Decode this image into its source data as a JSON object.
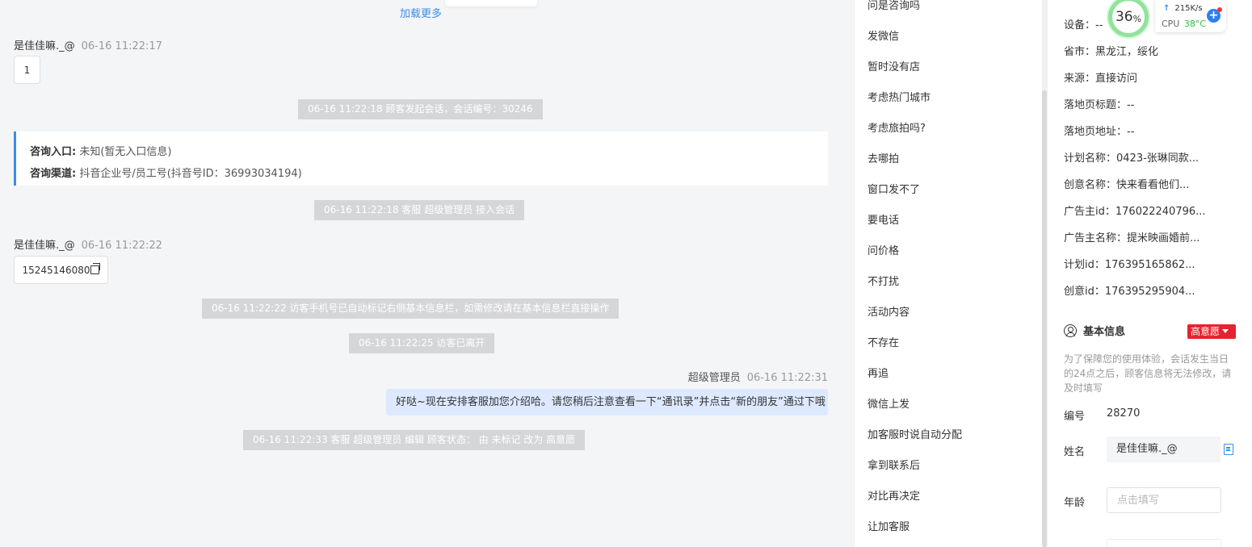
{
  "chat": {
    "load_more": "加载更多",
    "messages": [
      {
        "sender": "是佳佳嘛._@",
        "time": "06-16 11:22:17",
        "text": "1"
      },
      {
        "system": "06-16 11:22:18 顾客发起会话，会话编号：30246"
      },
      {
        "system": "06-16 11:22:18 客服 超级管理员 接入会话"
      },
      {
        "sender": "是佳佳嘛._@",
        "time": "06-16 11:22:22",
        "text": "15245146080"
      },
      {
        "system": "06-16 11:22:22 访客手机号已自动标记右侧基本信息栏，如需修改请在基本信息栏直接操作"
      },
      {
        "system": "06-16 11:22:25 访客已离开"
      },
      {
        "sender": "超级管理员",
        "time": "06-16 11:22:31",
        "text": "好哒~现在安排客服加您介绍哈。请您稍后注意查看一下“通讯录”并点击“新的朋友”通过下哦"
      },
      {
        "system": "06-16 11:22:33 客服 超级管理员 编辑 顾客状态： 由 未标记 改为 高意愿"
      }
    ],
    "entry_card": {
      "entry_label": "咨询入口:",
      "entry_value": "未知(暂无入口信息)",
      "channel_label": "咨询渠道:",
      "channel_value": "抖音企业号/员工号(抖音号ID：36993034194)"
    },
    "accent_color": "#3a8ee6"
  },
  "quick_replies": [
    "问是咨询吗",
    "发微信",
    "暂时没有店",
    "考虑热门城市",
    "考虑旅拍吗?",
    "去哪拍",
    "窗口发不了",
    "要电话",
    "问价格",
    "不打扰",
    "活动内容",
    "不存在",
    "再追",
    "微信上发",
    "加客服时说自动分配",
    "拿到联系后",
    "对比再决定",
    "让加客服"
  ],
  "visitor_info": [
    {
      "label": "设备：",
      "value": "--"
    },
    {
      "label": "省市：",
      "value": "黑龙江，绥化"
    },
    {
      "label": "来源：",
      "value": "直接访问"
    },
    {
      "label": "落地页标题：",
      "value": "--"
    },
    {
      "label": "落地页地址：",
      "value": "--"
    },
    {
      "label": "计划名称：",
      "value": "0423-张琳同款..."
    },
    {
      "label": "创意名称：",
      "value": "快来看看他们..."
    },
    {
      "label": "广告主id：",
      "value": "176022240796..."
    },
    {
      "label": "广告主名称：",
      "value": "提米映画婚前..."
    },
    {
      "label": "计划id：",
      "value": "176395165862..."
    },
    {
      "label": "创意id：",
      "value": "176395295904..."
    }
  ],
  "basic_info": {
    "title": "基本信息",
    "intent_badge": "高意愿",
    "intent_color": "#e6222e",
    "notice": "为了保障您的使用体验，会话发生当日的24点之后，顾客信息将无法修改，请及时填写",
    "number_label": "编号",
    "number_value": "28270",
    "name_label": "姓名",
    "name_value": "是佳佳嘛._@",
    "age_label": "年龄",
    "age_placeholder": "点击填写"
  },
  "monitor": {
    "cpu_percent": "36",
    "percent_sign": "%",
    "net_speed": "215K/s",
    "cpu_label": "CPU",
    "cpu_temp": "38°C"
  }
}
